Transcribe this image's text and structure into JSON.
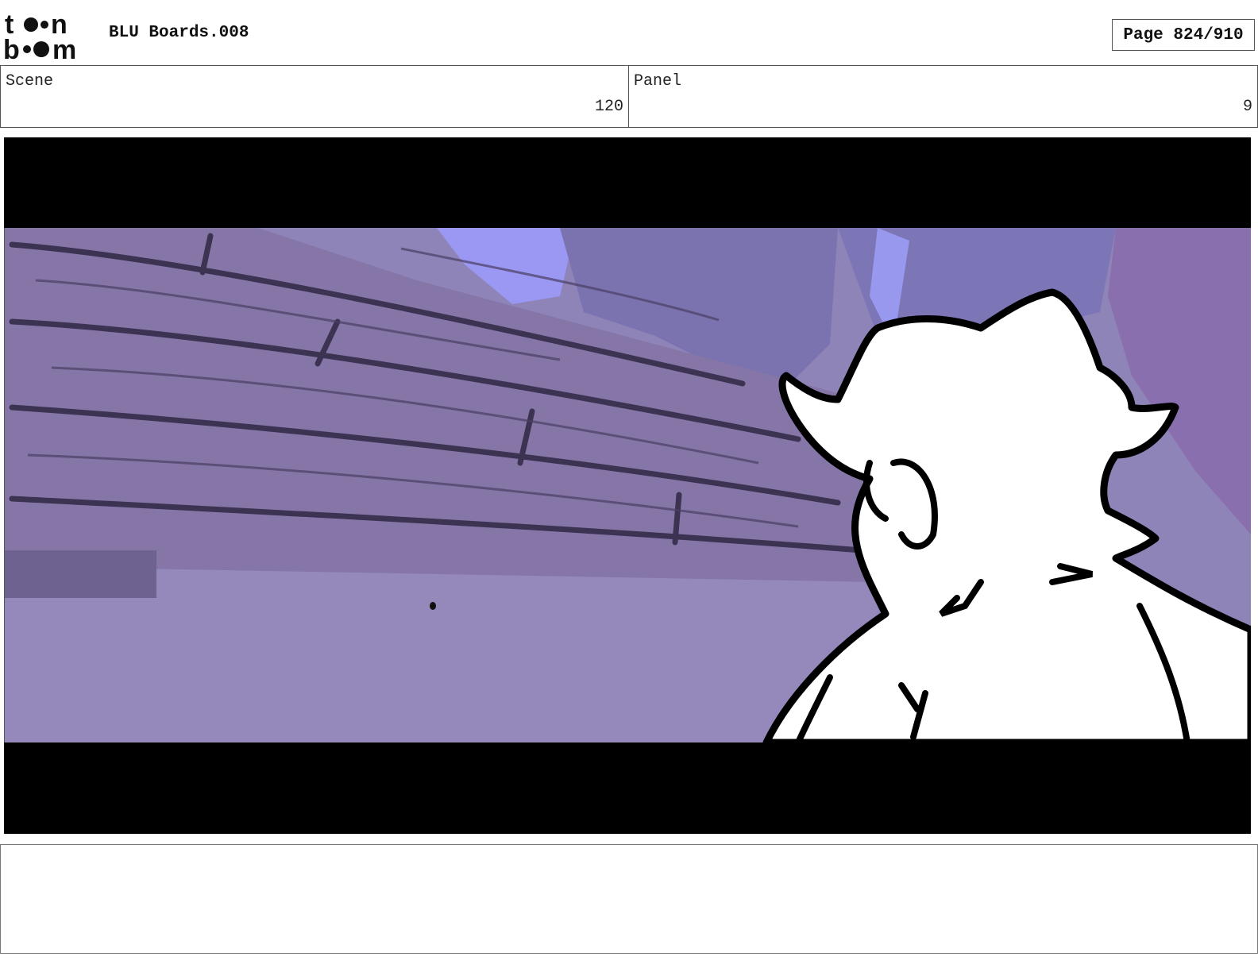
{
  "header": {
    "logo_text": "toon boom",
    "document_title": "BLU Boards.008",
    "page_indicator": "Page 824/910"
  },
  "info": {
    "scene_label": "Scene",
    "scene_value": "120",
    "panel_label": "Panel",
    "panel_value": "9"
  },
  "panel_image": {
    "description_icon": "storyboard-panel-image",
    "background_tint": "#8c7fb5",
    "sky_color": "#9a98f2",
    "letterbox_color": "#000000"
  },
  "caption": {
    "text": ""
  }
}
